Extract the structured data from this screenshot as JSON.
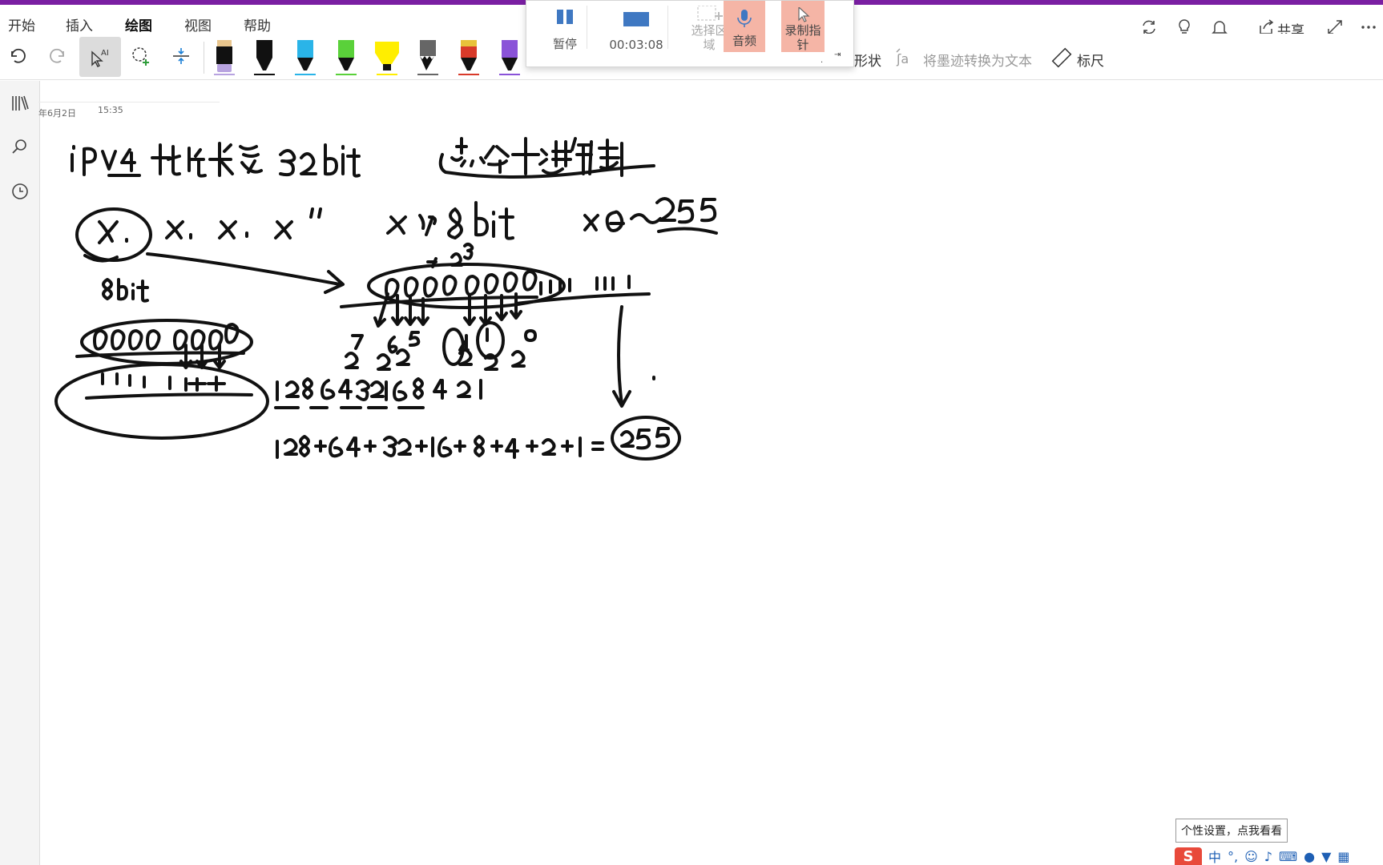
{
  "theme": {
    "accent": "#7a1fa2",
    "ink": "#111111",
    "highlight": "#f5b5a6"
  },
  "menu": {
    "tabs": [
      "开始",
      "插入",
      "绘图",
      "视图",
      "帮助"
    ],
    "active_tab": "绘图",
    "share_label": "共享"
  },
  "toolbar": {
    "ink_to_shape_partial": "形状",
    "ink_to_text": "将墨迹转换为文本",
    "ruler": "标尺",
    "pens": [
      {
        "color": "#b8a3e0",
        "kind": "eraser"
      },
      {
        "color": "#111111",
        "kind": "pen"
      },
      {
        "color": "#2ab4e8",
        "kind": "pen"
      },
      {
        "color": "#5ad13a",
        "kind": "pen"
      },
      {
        "color": "#ffee00",
        "kind": "highlighter"
      },
      {
        "color": "#666666",
        "kind": "pen"
      },
      {
        "color": "#d83a2a",
        "kind": "pen"
      },
      {
        "color": "#8a53d8",
        "kind": "pen"
      }
    ]
  },
  "recording": {
    "pause_label": "暂停",
    "timer": "00:03:08",
    "select_area_label": "选择区域",
    "audio_label": "音频",
    "record_pointer_label": "录制指针"
  },
  "page": {
    "date": "年6月2日",
    "time": "15:35"
  },
  "notes_text": {
    "line1": "IPv4 地址长度 32bit   点分十进制",
    "line2": "\"x. x. x. x\"  x为 8bit   x 0~255",
    "binary": "0000 0000",
    "ones": "1111 1111",
    "powers": "2^7 2^6 2^5 2^4 2^3 2^2 2^1 2^0",
    "weights": "128 64 32 16 8 4 2 1",
    "sum": "128+64+32+16+8+4+2+1=255",
    "label_8bit": "8bit"
  },
  "tooltip": "个性设置，点我看看",
  "ime": {
    "mode": "中"
  }
}
